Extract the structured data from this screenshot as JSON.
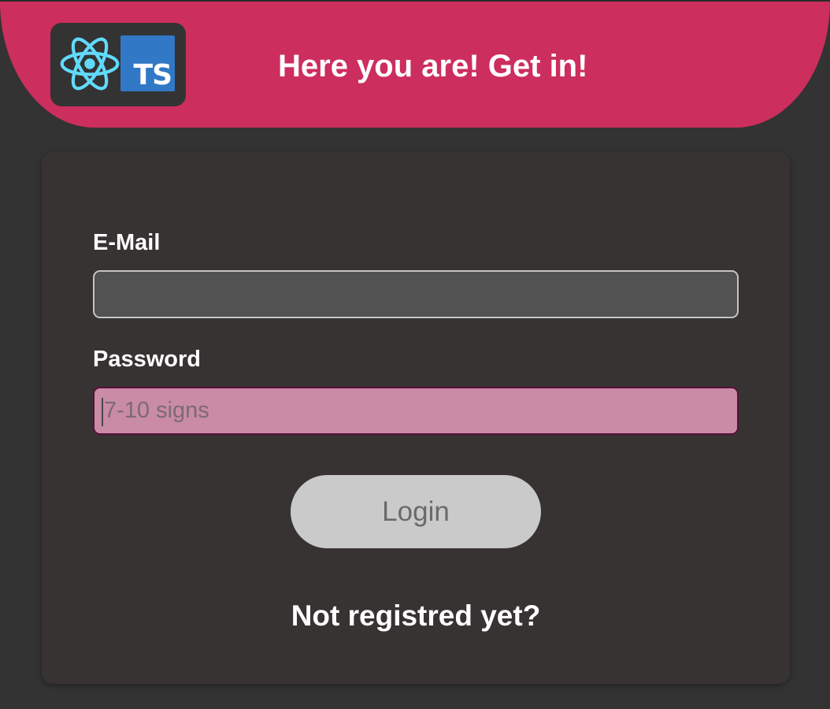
{
  "header": {
    "title": "Here you are! Get in!",
    "logo_icons": [
      "react-icon",
      "typescript-icon"
    ],
    "logo_ts_text": "TS",
    "background_color": "#cc2e5e"
  },
  "form": {
    "email": {
      "label": "E-Mail",
      "value": "",
      "placeholder": ""
    },
    "password": {
      "label": "Password",
      "value": "",
      "placeholder": "7-10 signs",
      "background_color": "#c98ba5"
    },
    "login_label": "Login",
    "register_link": "Not registred yet?"
  },
  "colors": {
    "page_background": "#333333",
    "card_background": "#373332",
    "accent": "#cc2e5e",
    "button_background": "#cacaca"
  }
}
